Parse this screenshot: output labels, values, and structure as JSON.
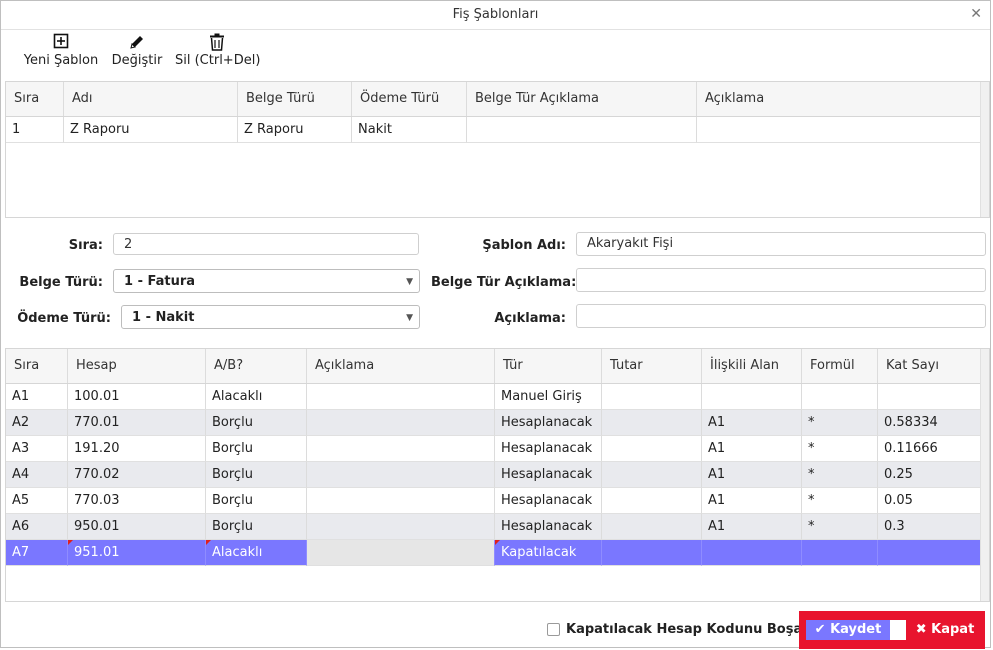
{
  "window": {
    "title": "Fiş Şablonları",
    "close_icon": "close-icon"
  },
  "toolbar": {
    "new_label": "Yeni Şablon",
    "edit_label": "Değiştir",
    "delete_label": "Sil (Ctrl+Del)"
  },
  "templates_grid": {
    "headers": [
      "Sıra",
      "Adı",
      "Belge Türü",
      "Ödeme Türü",
      "Belge Tür Açıklama",
      "Açıklama"
    ],
    "rows": [
      [
        "1",
        "Z Raporu",
        "Z Raporu",
        "Nakit",
        "",
        ""
      ]
    ]
  },
  "form": {
    "sira_label": "Sıra:",
    "sira_value": "2",
    "belge_turu_label": "Belge Türü:",
    "belge_turu_value": "1 - Fatura",
    "odeme_turu_label": "Ödeme Türü:",
    "odeme_turu_value": "1 - Nakit",
    "sablon_adi_label": "Şablon Adı:",
    "sablon_adi_value": "Akaryakıt Fişi",
    "belge_tur_aciklama_label": "Belge Tür Açıklama:",
    "belge_tur_aciklama_value": "",
    "aciklama_label": "Açıklama:",
    "aciklama_value": ""
  },
  "lines_grid": {
    "headers": [
      "Sıra",
      "Hesap",
      "A/B?",
      "Açıklama",
      "Tür",
      "Tutar",
      "İlişkili Alan",
      "Formül",
      "Kat Sayı"
    ],
    "rows": [
      [
        "A1",
        "100.01",
        "Alacaklı",
        "",
        "Manuel Giriş",
        "",
        "",
        "",
        ""
      ],
      [
        "A2",
        "770.01",
        "Borçlu",
        "",
        "Hesaplanacak",
        "",
        "A1",
        "*",
        "0.58334"
      ],
      [
        "A3",
        "191.20",
        "Borçlu",
        "",
        "Hesaplanacak",
        "",
        "A1",
        "*",
        "0.11666"
      ],
      [
        "A4",
        "770.02",
        "Borçlu",
        "",
        "Hesaplanacak",
        "",
        "A1",
        "*",
        "0.25"
      ],
      [
        "A5",
        "770.03",
        "Borçlu",
        "",
        "Hesaplanacak",
        "",
        "A1",
        "*",
        "0.05"
      ],
      [
        "A6",
        "950.01",
        "Borçlu",
        "",
        "Hesaplanacak",
        "",
        "A1",
        "*",
        "0.3"
      ],
      [
        "A7",
        "951.01",
        "Alacaklı",
        "",
        "Kapatılacak",
        "",
        "",
        "",
        ""
      ]
    ],
    "selected_row": 6
  },
  "footer": {
    "checkbox_label": "Kapatılacak Hesap Kodunu Boşalt",
    "checkbox_checked": false,
    "save_label": "Kaydet",
    "close_label": "Kapat"
  },
  "colors": {
    "accent": "#7a77ff",
    "danger": "#e8142e",
    "row_alt": "#e9eaee"
  }
}
